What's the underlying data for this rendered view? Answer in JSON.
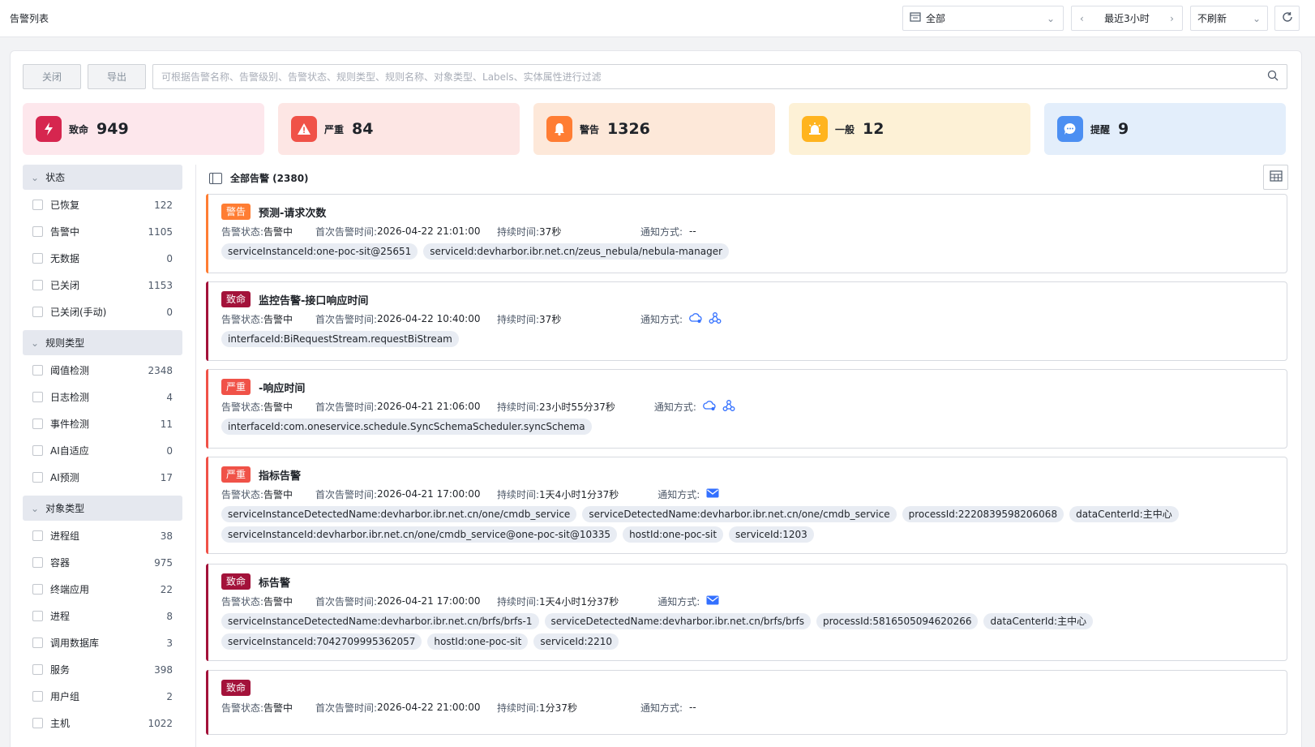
{
  "header": {
    "title": "告警列表",
    "filter_value": "全部",
    "time_range": "最近3小时",
    "refresh_mode": "不刷新"
  },
  "toolbar": {
    "close_label": "关闭",
    "export_label": "导出",
    "search_placeholder": "可根据告警名称、告警级别、告警状态、规则类型、规则名称、对象类型、Labels、实体属性进行过滤"
  },
  "stats": [
    {
      "label": "致命",
      "count": "949",
      "bg": "#fde7ec",
      "icon_bg": "#d6264f",
      "icon": "lightning-icon"
    },
    {
      "label": "严重",
      "count": "84",
      "bg": "#fde6e4",
      "icon_bg": "#f05248",
      "icon": "warning-icon"
    },
    {
      "label": "警告",
      "count": "1326",
      "bg": "#fde8d9",
      "icon_bg": "#ff7d33",
      "icon": "bell-icon"
    },
    {
      "label": "一般",
      "count": "12",
      "bg": "#fdf1d6",
      "icon_bg": "#ffb41f",
      "icon": "alarm-icon"
    },
    {
      "label": "提醒",
      "count": "9",
      "bg": "#e3eefb",
      "icon_bg": "#4c8ff2",
      "icon": "message-icon"
    }
  ],
  "sidebar": [
    {
      "title": "状态",
      "items": [
        {
          "name": "已恢复",
          "count": "122"
        },
        {
          "name": "告警中",
          "count": "1105"
        },
        {
          "name": "无数据",
          "count": "0"
        },
        {
          "name": "已关闭",
          "count": "1153"
        },
        {
          "name": "已关闭(手动)",
          "count": "0"
        }
      ]
    },
    {
      "title": "规则类型",
      "items": [
        {
          "name": "阈值检测",
          "count": "2348"
        },
        {
          "name": "日志检测",
          "count": "4"
        },
        {
          "name": "事件检测",
          "count": "11"
        },
        {
          "name": "AI自适应",
          "count": "0"
        },
        {
          "name": "AI预测",
          "count": "17"
        }
      ]
    },
    {
      "title": "对象类型",
      "items": [
        {
          "name": "进程组",
          "count": "38"
        },
        {
          "name": "容器",
          "count": "975"
        },
        {
          "name": "终端应用",
          "count": "22"
        },
        {
          "name": "进程",
          "count": "8"
        },
        {
          "name": "调用数据库",
          "count": "3"
        },
        {
          "name": "服务",
          "count": "398"
        },
        {
          "name": "用户组",
          "count": "2"
        },
        {
          "name": "主机",
          "count": "1022"
        }
      ]
    }
  ],
  "list": {
    "title": "全部告警 (2380)"
  },
  "labels": {
    "status": "告警状态: ",
    "first_time": "首次告警时间: ",
    "duration": "持续时间: ",
    "notify": "通知方式: "
  },
  "alerts": [
    {
      "level": "警告",
      "color": "#ff7d33",
      "name": "预测-请求次数",
      "status": "告警中",
      "first_time": "2026-04-22 21:01:00",
      "duration": "37秒",
      "notify_text": "--",
      "notify_icons": [],
      "tags": [
        "serviceInstanceId:one-poc-sit@25651",
        "serviceId:devharbor.ibr.net.cn/zeus_nebula/nebula-manager"
      ]
    },
    {
      "level": "致命",
      "color": "#a3123a",
      "name": "监控告警-接口响应时间",
      "status": "告警中",
      "first_time": "2026-04-22 10:40:00",
      "duration": "37秒",
      "notify_text": "",
      "notify_icons": [
        "cloud-notify-icon",
        "webhook-icon"
      ],
      "tags": [
        "interfaceId:BiRequestStream.requestBiStream"
      ]
    },
    {
      "level": "严重",
      "color": "#f05248",
      "name": "-响应时间",
      "status": "告警中",
      "first_time": "2026-04-21 21:06:00",
      "duration": "23小时55分37秒",
      "notify_text": "",
      "notify_icons": [
        "cloud-notify-icon",
        "webhook-icon"
      ],
      "tags": [
        "interfaceId:com.oneservice.schedule.SyncSchemaScheduler.syncSchema"
      ]
    },
    {
      "level": "严重",
      "color": "#f05248",
      "name": "指标告警",
      "status": "告警中",
      "first_time": "2026-04-21 17:00:00",
      "duration": "1天4小时1分37秒",
      "notify_text": "",
      "notify_icons": [
        "email-icon"
      ],
      "tags": [
        "serviceInstanceDetectedName:devharbor.ibr.net.cn/one/cmdb_service",
        "serviceDetectedName:devharbor.ibr.net.cn/one/cmdb_service",
        "processId:2220839598206068",
        "dataCenterId:主中心",
        "serviceInstanceId:devharbor.ibr.net.cn/one/cmdb_service@one-poc-sit@10335",
        "hostId:one-poc-sit",
        "serviceId:1203"
      ]
    },
    {
      "level": "致命",
      "color": "#a3123a",
      "name": "标告警",
      "status": "告警中",
      "first_time": "2026-04-21 17:00:00",
      "duration": "1天4小时1分37秒",
      "notify_text": "",
      "notify_icons": [
        "email-icon"
      ],
      "tags": [
        "serviceInstanceDetectedName:devharbor.ibr.net.cn/brfs/brfs-1",
        "serviceDetectedName:devharbor.ibr.net.cn/brfs/brfs",
        "processId:5816505094620266",
        "dataCenterId:主中心",
        "serviceInstanceId:7042709995362057",
        "hostId:one-poc-sit",
        "serviceId:2210"
      ]
    },
    {
      "level": "致命",
      "color": "#a3123a",
      "name": "",
      "status": "告警中",
      "first_time": "2026-04-22 21:00:00",
      "duration": "1分37秒",
      "notify_text": "--",
      "notify_icons": [],
      "tags": []
    }
  ]
}
